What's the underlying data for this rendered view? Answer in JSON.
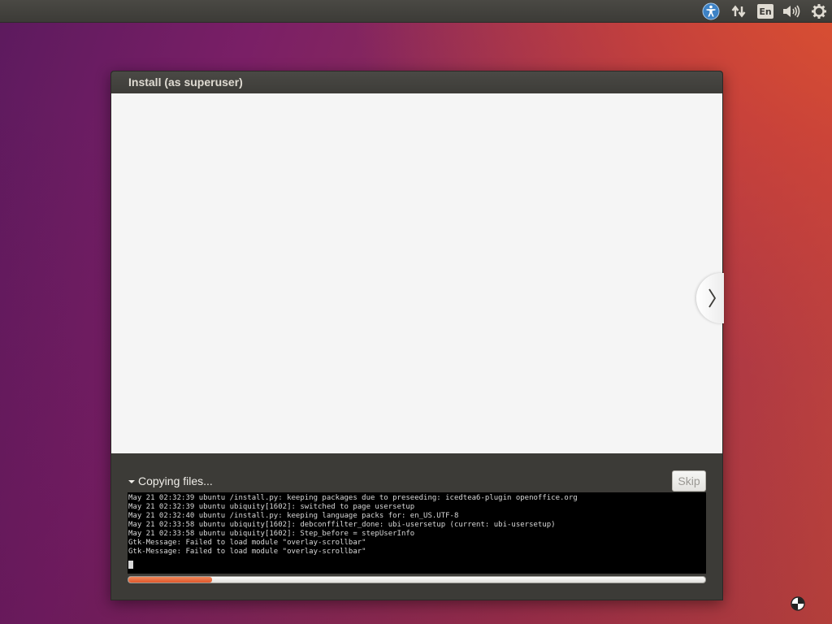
{
  "top_panel": {
    "indicators": {
      "accessibility_icon": "universal-access-icon",
      "network_icon": "network-arrows-icon",
      "keyboard_layout": "En",
      "sound_icon": "speaker-icon",
      "system_icon": "gear-icon"
    },
    "accent_color": "#3c3b37"
  },
  "window": {
    "title": "Install (as superuser)",
    "next_icon": "chevron-right-icon",
    "progress": {
      "label": "Copying files...",
      "skip_label": "Skip",
      "fraction": 0.145,
      "fill_color": "#e95420"
    },
    "log_lines": [
      "May 21 02:32:39 ubuntu /install.py: keeping packages due to preseeding: icedtea6-plugin openoffice.org",
      "May 21 02:32:39 ubuntu ubiquity[1602]: switched to page usersetup",
      "May 21 02:32:40 ubuntu /install.py: keeping language packs for: en_US.UTF-8",
      "May 21 02:33:58 ubuntu ubiquity[1602]: debconffilter_done: ubi-usersetup (current: ubi-usersetup)",
      "May 21 02:33:58 ubuntu ubiquity[1602]: Step_before = stepUserInfo",
      "Gtk-Message: Failed to load module \"overlay-scrollbar\"",
      "Gtk-Message: Failed to load module \"overlay-scrollbar\""
    ]
  },
  "desktop": {
    "cursor_icon": "busy-cursor-icon"
  }
}
